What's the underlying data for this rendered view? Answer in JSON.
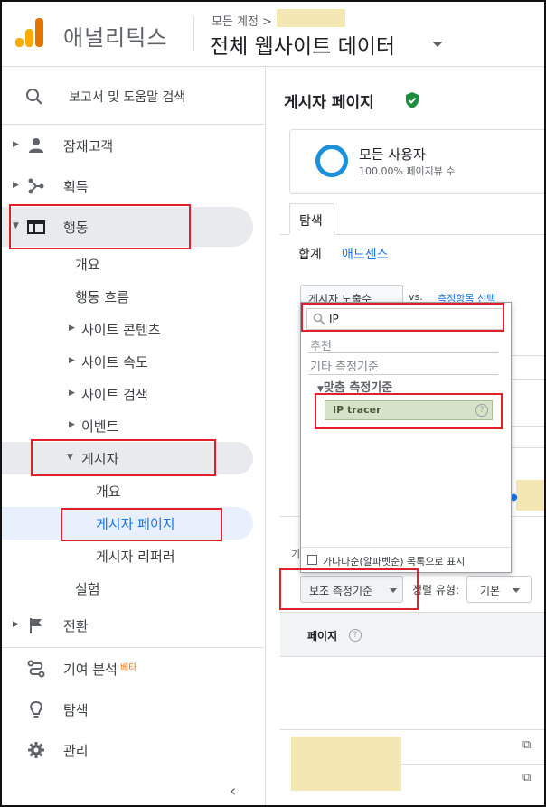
{
  "header": {
    "app_name": "애널리틱스",
    "breadcrumb": "모든 계정 >",
    "view_name": "전체 웹사이트 데이터"
  },
  "sidebar": {
    "search_label": "보고서 및 도움말 검색",
    "items": {
      "audience": "잠재고객",
      "acquisition": "획득",
      "behavior": "행동",
      "conversions": "전환",
      "attribution": "기여 분석",
      "attribution_badge": "베타",
      "discover": "탐색",
      "admin": "관리"
    },
    "behavior_sub": {
      "overview": "개요",
      "behavior_flow": "행동 흐름",
      "site_content": "사이트 콘텐츠",
      "site_speed": "사이트 속도",
      "site_search": "사이트 검색",
      "events": "이벤트",
      "publisher": "게시자",
      "experiments": "실험"
    },
    "publisher_sub": {
      "overview": "개요",
      "publisher_pages": "게시자 페이지",
      "publisher_referrers": "게시자 리퍼러"
    },
    "collapse_glyph": "‹"
  },
  "main": {
    "page_title": "게시자 페이지",
    "segment": {
      "name": "모든 사용자",
      "subtitle": "100.00% 페이지뷰 수"
    },
    "tab": "탐색",
    "subtabs": [
      "합계",
      "애드센스"
    ],
    "metric_select": "게시자 노출수",
    "vs": "vs.",
    "choose_metric": "측정항목 선택",
    "cut_label": "기",
    "secondary_dimension": "보조 측정기준",
    "sort_label": "정렬 유형:",
    "sort_value": "기본",
    "table_header": "페이지",
    "help_glyph": "?",
    "ext_glyph": "⧉"
  },
  "popup": {
    "search_value": "IP",
    "headers": [
      "추천",
      "기타 측정기준"
    ],
    "group": "맞춤 측정기준",
    "option": "IP tracer",
    "footer": "가나다순(알파벳순) 목록으로 표시"
  },
  "colors": {
    "accent": "#1a73e8",
    "annotation": "#e0202a",
    "redaction": "#f3e7b3",
    "logo_light": "#f9ab00",
    "logo_dark": "#e37400"
  }
}
